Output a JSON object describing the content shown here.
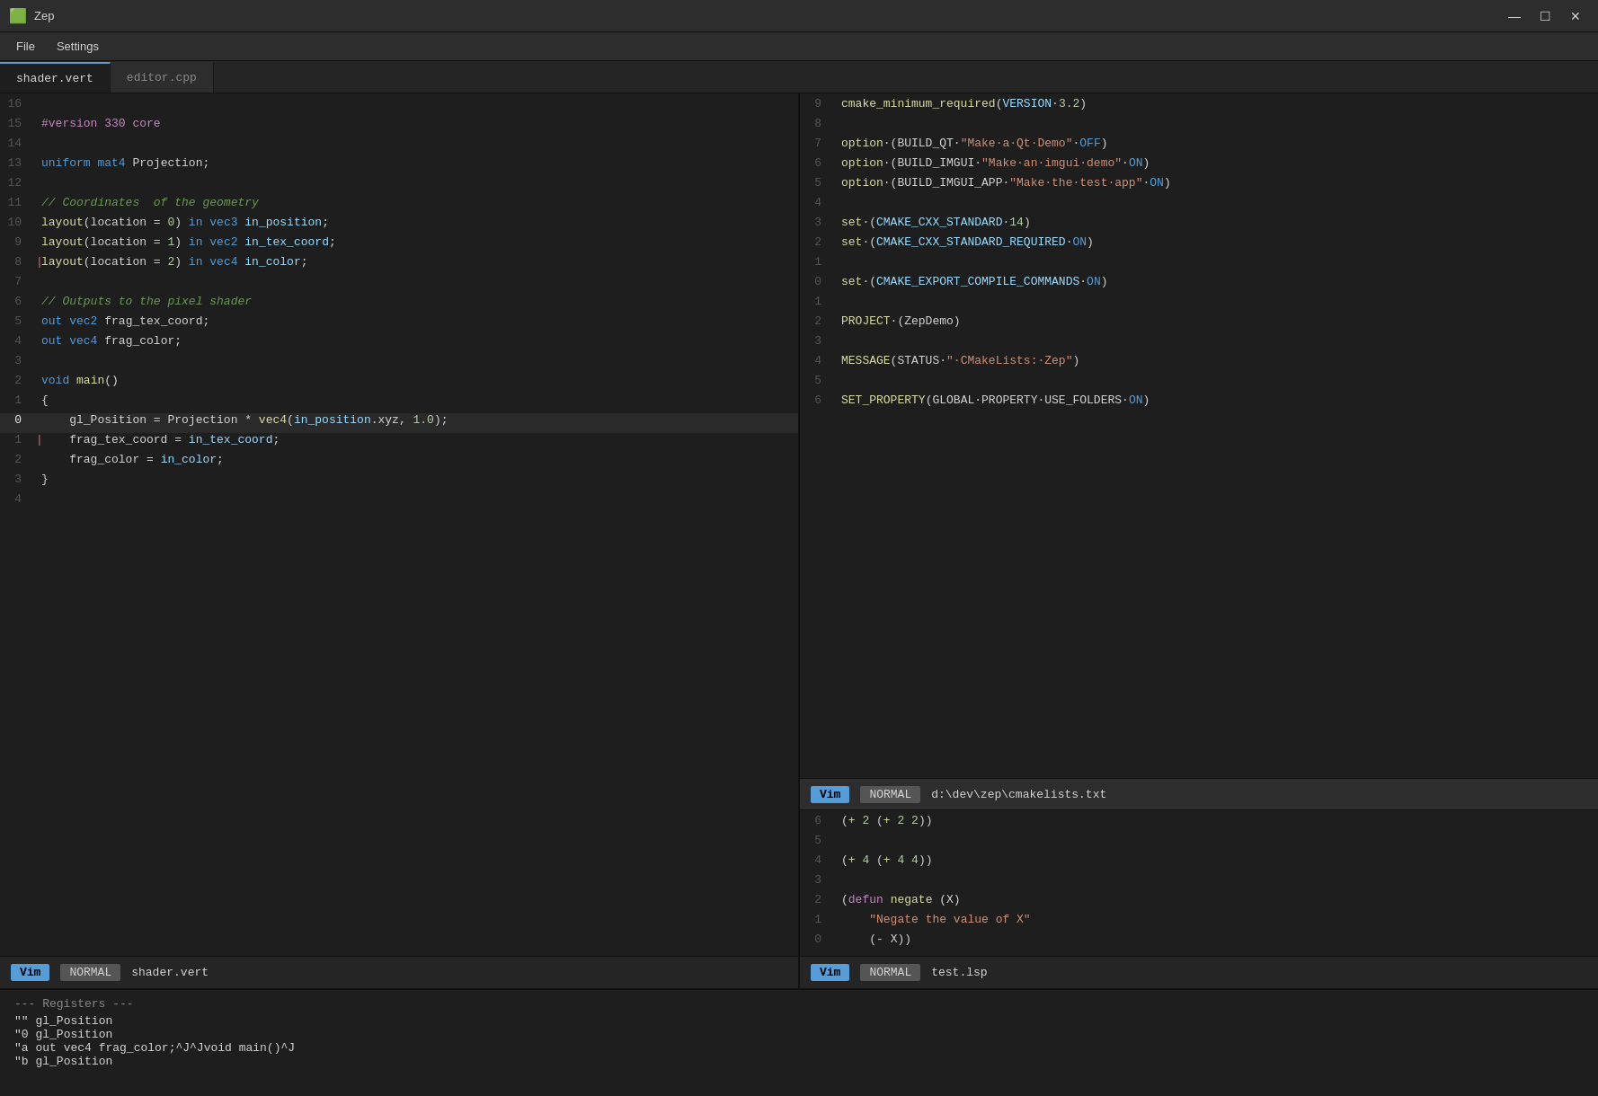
{
  "app": {
    "title": "Zep",
    "icon": "🟩"
  },
  "titlebar": {
    "minimize": "—",
    "maximize": "☐",
    "close": "✕"
  },
  "menubar": {
    "items": [
      "File",
      "Settings"
    ]
  },
  "tabs": [
    {
      "id": "shader",
      "label": "shader.vert",
      "active": true
    },
    {
      "id": "editor",
      "label": "editor.cpp",
      "active": false
    }
  ],
  "left_editor": {
    "status": {
      "vim": "Vim",
      "mode": "NORMAL",
      "file": "shader.vert"
    },
    "lines": [
      {
        "num": "16",
        "content": ""
      },
      {
        "num": "15",
        "content": "#version 330 core",
        "color": "macro"
      },
      {
        "num": "14",
        "content": ""
      },
      {
        "num": "13",
        "content": "uniform mat4 Projection;"
      },
      {
        "num": "12",
        "content": ""
      },
      {
        "num": "11",
        "content": "// Coordinates  of the geometry",
        "color": "comment"
      },
      {
        "num": "10",
        "content": "layout(location = 0) in vec3 in_position;"
      },
      {
        "num": "9",
        "content": "layout(location = 1) in vec2 in_tex_coord;"
      },
      {
        "num": "8",
        "content": "layout(location = 2) in vec4 in_color;",
        "marker": "red"
      },
      {
        "num": "7",
        "content": ""
      },
      {
        "num": "6",
        "content": "// Outputs to the pixel shader",
        "color": "comment"
      },
      {
        "num": "5",
        "content": "out vec2 frag_tex_coord;"
      },
      {
        "num": "4",
        "content": "out vec4 frag_color;"
      },
      {
        "num": "3",
        "content": ""
      },
      {
        "num": "2",
        "content": "void main()"
      },
      {
        "num": "1",
        "content": "{"
      },
      {
        "num": "0",
        "content": "    gl_Position = Projection * vec4(in_position.xyz, 1.0);",
        "highlight": true
      },
      {
        "num": "1",
        "content": "    frag_tex_coord = in_tex_coord;",
        "marker": "red2"
      },
      {
        "num": "2",
        "content": "    frag_color = in_color;"
      },
      {
        "num": "3",
        "content": "}"
      },
      {
        "num": "4",
        "content": ""
      }
    ]
  },
  "right_top_editor": {
    "status": {
      "vim": "Vim",
      "mode": "NORMAL",
      "file": "d:\\dev\\zep\\cmakelists.txt"
    },
    "lines": [
      {
        "num": "9",
        "content": "cmake_minimum_required(VERSION·3.2)"
      },
      {
        "num": "8",
        "content": ""
      },
      {
        "num": "7",
        "content": "option·(BUILD_QT·\"Make·a·Qt·Demo\"·OFF)"
      },
      {
        "num": "6",
        "content": "option·(BUILD_IMGUI·\"Make·an·imgui·demo\"·ON)"
      },
      {
        "num": "5",
        "content": "option·(BUILD_IMGUI_APP·\"Make·the·test·app\"·ON)"
      },
      {
        "num": "4",
        "content": ""
      },
      {
        "num": "3",
        "content": "set·(CMAKE_CXX_STANDARD·14)"
      },
      {
        "num": "2",
        "content": "set·(CMAKE_CXX_STANDARD_REQUIRED·ON)"
      },
      {
        "num": "1",
        "content": ""
      },
      {
        "num": "0",
        "content": "set·(CMAKE_EXPORT_COMPILE_COMMANDS·ON)"
      },
      {
        "num": "1",
        "content": ""
      },
      {
        "num": "2",
        "content": "PROJECT·(ZepDemo)"
      },
      {
        "num": "3",
        "content": ""
      },
      {
        "num": "4",
        "content": "MESSAGE(STATUS·\"·CMakeLists:·Zep\")"
      },
      {
        "num": "5",
        "content": ""
      },
      {
        "num": "6",
        "content": "SET_PROPERTY(GLOBAL·PROPERTY·USE_FOLDERS·ON)"
      }
    ]
  },
  "right_bottom_editor": {
    "status": {
      "vim": "Vim",
      "mode": "NORMAL",
      "file": "test.lsp"
    },
    "lines": [
      {
        "num": "6",
        "content": "(+ 2 (+ 2 2))"
      },
      {
        "num": "5",
        "content": ""
      },
      {
        "num": "4",
        "content": "(+ 4 (+ 4 4))"
      },
      {
        "num": "3",
        "content": ""
      },
      {
        "num": "2",
        "content": "(defun negate (X)"
      },
      {
        "num": "1",
        "content": "    \"Negate the value of X\""
      },
      {
        "num": "0",
        "content": "    (- X))"
      }
    ]
  },
  "registers": {
    "title": "--- Registers ---",
    "items": [
      {
        "reg": "\"\"",
        "val": "   gl_Position"
      },
      {
        "reg": "\"0",
        "val": "  gl_Position"
      },
      {
        "reg": "\"a",
        "val": "  out vec4 frag_color;^J^Jvoid main()^J"
      },
      {
        "reg": "\"b",
        "val": "  gl_Position"
      }
    ]
  }
}
